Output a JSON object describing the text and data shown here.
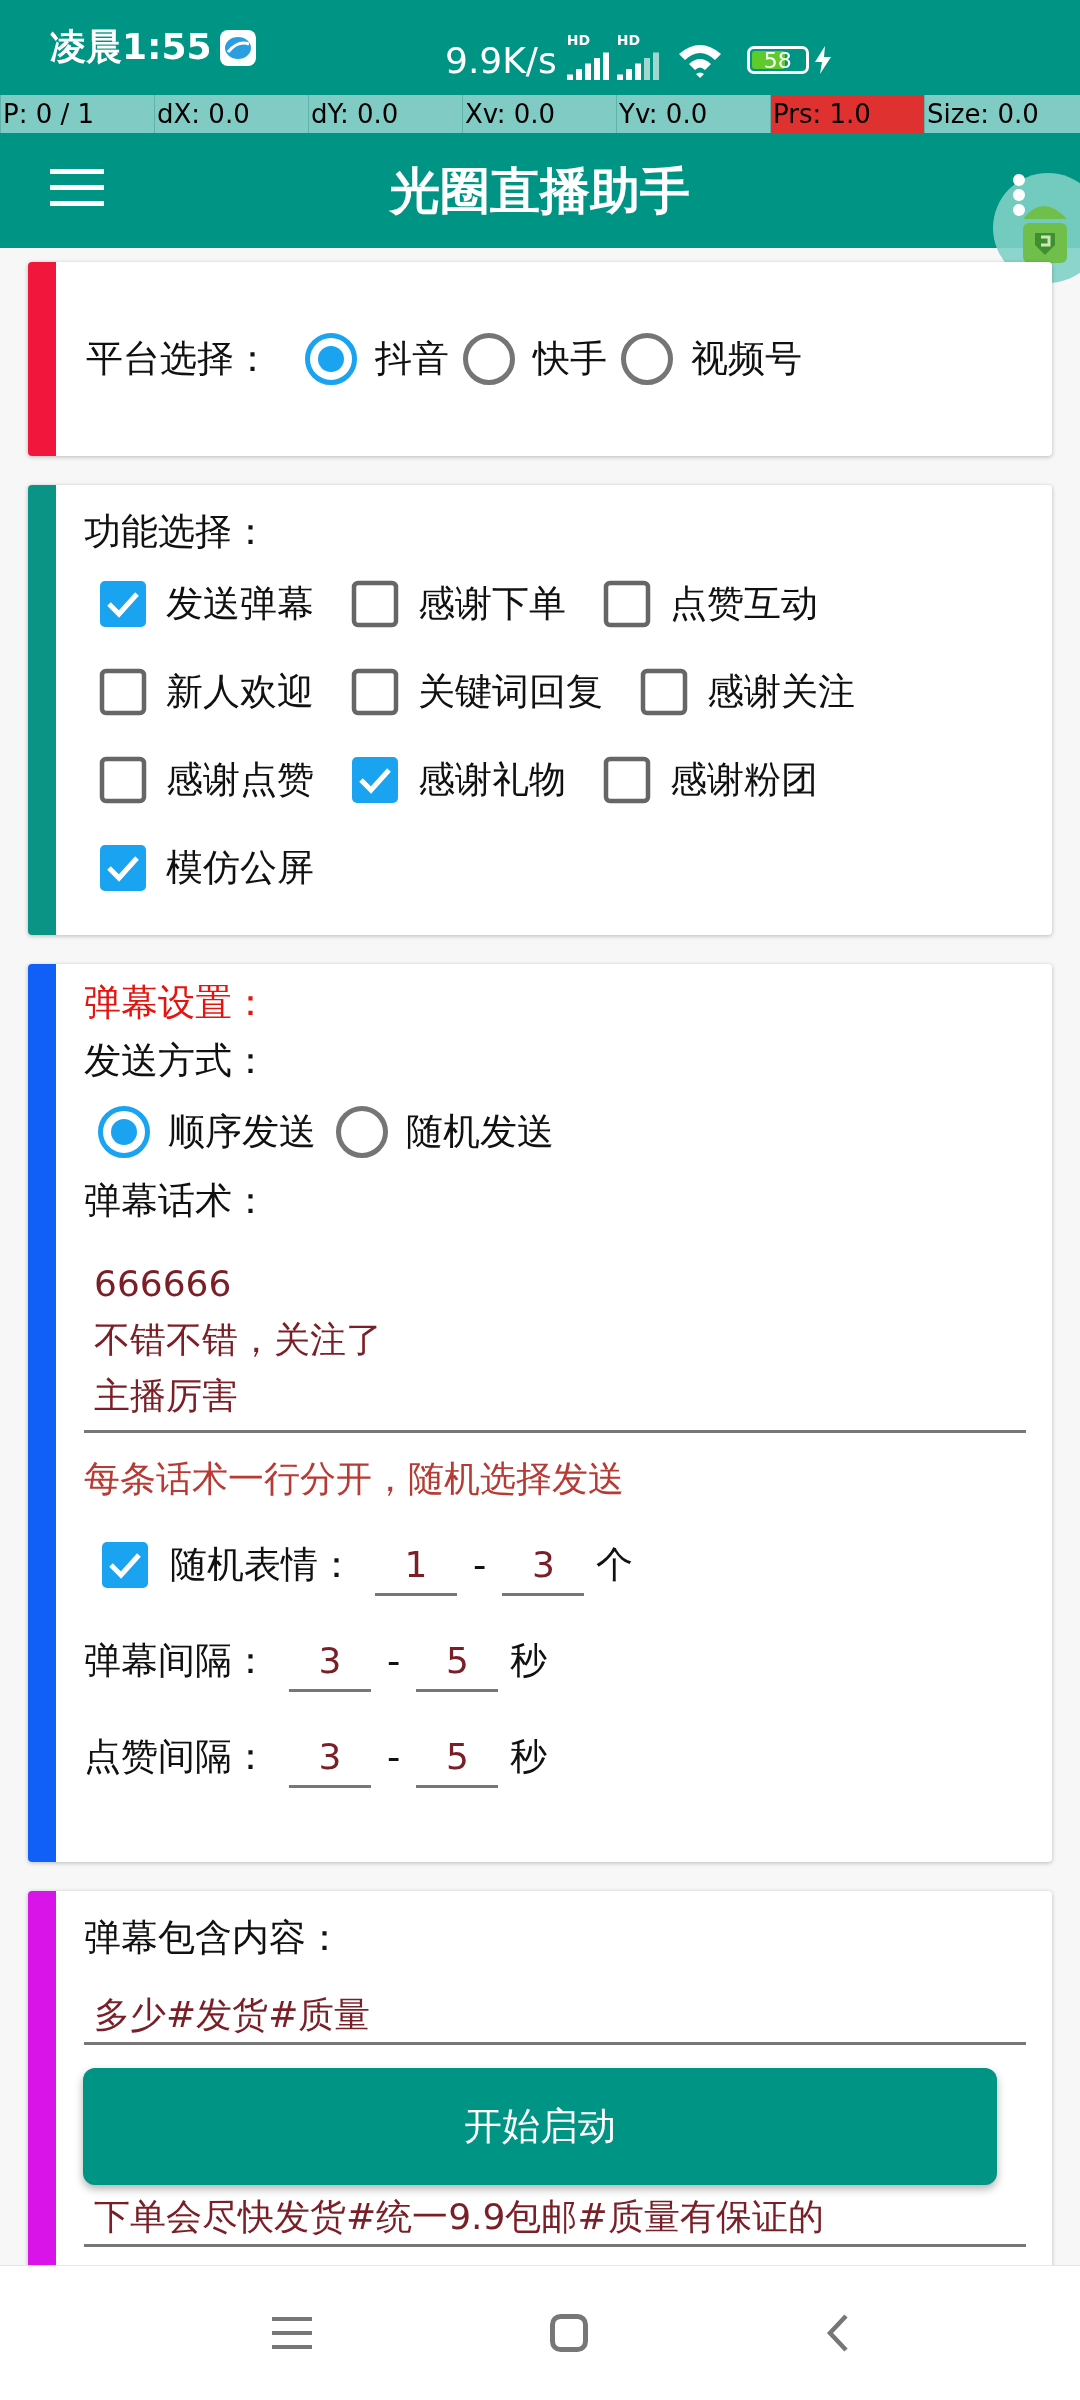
{
  "status_bar": {
    "time": "凌晨1:55",
    "speed": "9.9K/s",
    "signals": [
      {
        "label": "HD"
      },
      {
        "label": "HD"
      }
    ],
    "battery": "58"
  },
  "debug_bar": {
    "cells": [
      {
        "text": "P: 0 / 1",
        "highlighted": false
      },
      {
        "text": "dX: 0.0",
        "highlighted": false
      },
      {
        "text": "dY: 0.0",
        "highlighted": false
      },
      {
        "text": "Xv: 0.0",
        "highlighted": false
      },
      {
        "text": "Yv: 0.0",
        "highlighted": false
      },
      {
        "text": "Prs: 1.0",
        "highlighted": true
      },
      {
        "text": "Size: 0.0",
        "highlighted": false
      }
    ]
  },
  "app_bar": {
    "title": "光圈直播助手"
  },
  "platform_card": {
    "color": "#f0163c",
    "label": "平台选择：",
    "options": [
      {
        "label": "抖音",
        "selected": true
      },
      {
        "label": "快手",
        "selected": false
      },
      {
        "label": "视频号",
        "selected": false
      }
    ]
  },
  "feature_card": {
    "color": "#0a9485",
    "label": "功能选择：",
    "rows": [
      [
        {
          "label": "发送弹幕",
          "checked": true
        },
        {
          "label": "感谢下单",
          "checked": false
        },
        {
          "label": "点赞互动",
          "checked": false
        }
      ],
      [
        {
          "label": "新人欢迎",
          "checked": false
        },
        {
          "label": "关键词回复",
          "checked": false
        },
        {
          "label": "感谢关注",
          "checked": false
        }
      ],
      [
        {
          "label": "感谢点赞",
          "checked": false
        },
        {
          "label": "感谢礼物",
          "checked": true
        },
        {
          "label": "感谢粉团",
          "checked": false
        }
      ],
      [
        {
          "label": "模仿公屏",
          "checked": true
        }
      ]
    ]
  },
  "danmaku_card": {
    "color": "#1060f8",
    "title": "弹幕设置：",
    "mode_label": "发送方式：",
    "modes": [
      {
        "label": "顺序发送",
        "selected": true
      },
      {
        "label": "随机发送",
        "selected": false
      }
    ],
    "script_label": "弹幕话术：",
    "script_lines": [
      "666666",
      "不错不错，关注了",
      "主播厉害"
    ],
    "script_hint": "每条话术一行分开，随机选择发送",
    "emoji": {
      "checked": true,
      "label": "随机表情：",
      "min": "1",
      "separator": "-",
      "max": "3",
      "unit": "个"
    },
    "intervals": [
      {
        "label": "弹幕间隔：",
        "min": "3",
        "separator": "-",
        "max": "5",
        "unit": "秒"
      },
      {
        "label": "点赞间隔：",
        "min": "3",
        "separator": "-",
        "max": "5",
        "unit": "秒"
      }
    ]
  },
  "keyword_card": {
    "color": "#d814e8",
    "label": "弹幕包含内容：",
    "fields": [
      {
        "value": "多少#发货#质量"
      },
      {
        "value": "下单会尽快发货#统一9.9包邮#质量有保证的"
      }
    ]
  },
  "start_button": {
    "label": "开始启动"
  }
}
